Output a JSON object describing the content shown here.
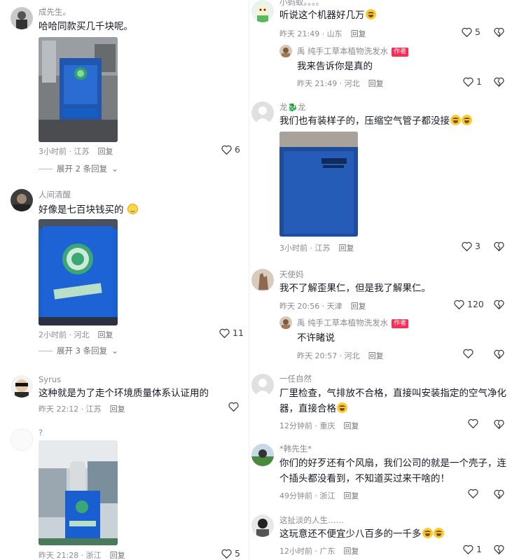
{
  "left": {
    "c1": {
      "user": "成先生。",
      "text": "哈哈同款买几千块呢。",
      "time": "3小时前 · 江苏",
      "reply": "回复",
      "likes": "6",
      "expand": "展开 2 条回复",
      "img_label": "烟雾净化器"
    },
    "c2": {
      "user": "人间清醒",
      "text": "好像是七百块钱买的",
      "time": "2小时前 · 河北",
      "reply": "回复",
      "likes": "11",
      "expand": "展开 3 条回复",
      "img_label": "焊烟净化器"
    },
    "c3": {
      "user": "Syrus",
      "text": "这种就是为了走个环境质量体系认证用的",
      "time": "昨天 22:12 · 江苏",
      "reply": "回复"
    },
    "c4": {
      "user": "?",
      "time": "昨天 21:28 · 浙江",
      "reply": "回复",
      "likes": "5",
      "img_label": "焊烟净化器"
    }
  },
  "right": {
    "c1": {
      "user": "小蚂蚁。。。。",
      "text": "听说这个机器好几万",
      "time": "昨天 21:49 · 山东",
      "reply": "回复",
      "likes": "5"
    },
    "r1": {
      "user": "禹  纯手工草本植物洗发水",
      "tag": "作者",
      "text": "我来告诉你是真的",
      "time": "昨天 21:49 · 河北",
      "reply": "回复",
      "likes": "1"
    },
    "c2": {
      "user": "龙🐉龙",
      "text": "我们也有装样子的，压缩空气管子都没接",
      "time": "3小时前 · 江苏",
      "reply": "回复",
      "likes": "3"
    },
    "c3": {
      "user": "天使妈",
      "text": "我不了解歪果仁，但是我了解果仁。",
      "time": "昨天 20:56 · 天津",
      "reply": "回复",
      "likes": "120"
    },
    "r2": {
      "user": "禹  纯手工草本植物洗发水",
      "tag": "作者",
      "text": "不许睹说",
      "time": "昨天 20:57 · 河北",
      "reply": "回复"
    },
    "c4": {
      "user": "一任自然",
      "text1": "厂里检查，气排放不合格，直接叫安装指定的空气净化",
      "text2": "器，直接合格",
      "time": "12分钟前 · 重庆",
      "reply": "回复"
    },
    "c5": {
      "user": "*韩先生*",
      "text1": "你们的好歹还有个风扇，我们公司的就是一个壳子，连",
      "text2": "个插头都没看到，不知道买过来干啥的！",
      "time": "49分钟前 · 浙江",
      "reply": "回复"
    },
    "c6": {
      "user": "这扯淡的人生……",
      "text": "这玩意还不便宜少八百多的一千多",
      "time": "12小时前 · 广东",
      "reply": "回复",
      "likes": "1"
    }
  }
}
